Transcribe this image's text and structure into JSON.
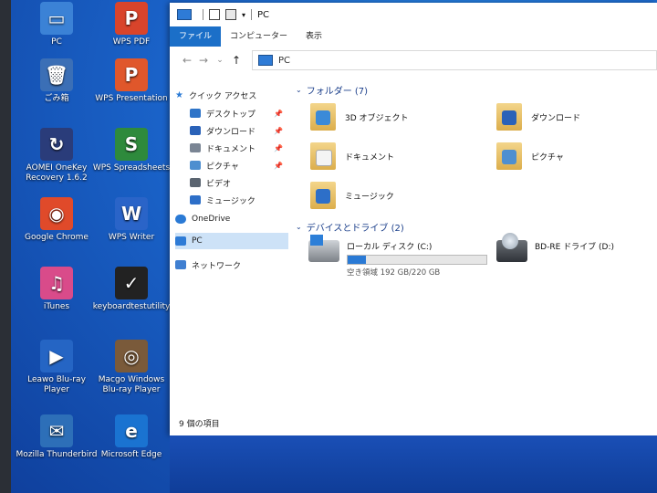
{
  "desktop": {
    "icons": [
      {
        "label": "PC",
        "glyph": "▭",
        "color": "#3b82d6"
      },
      {
        "label": "WPS PDF",
        "glyph": "P",
        "color": "#d9442b"
      },
      {
        "label": "ごみ箱",
        "glyph": "🗑",
        "color": "#3b6fb6"
      },
      {
        "label": "WPS Presentation",
        "glyph": "P",
        "color": "#e0572b"
      },
      {
        "label": "AOMEI OneKey Recovery 1.6.2",
        "glyph": "↻",
        "color": "#2a3c7a"
      },
      {
        "label": "WPS Spreadsheets",
        "glyph": "S",
        "color": "#2e8a3c"
      },
      {
        "label": "Google Chrome",
        "glyph": "◉",
        "color": "#e04a2a"
      },
      {
        "label": "WPS Writer",
        "glyph": "W",
        "color": "#2a64c8"
      },
      {
        "label": "iTunes",
        "glyph": "♫",
        "color": "#d94b8a"
      },
      {
        "label": "keyboardtestutility",
        "glyph": "✓",
        "color": "#222222"
      },
      {
        "label": "Leawo Blu-ray Player",
        "glyph": "▶",
        "color": "#2565c4"
      },
      {
        "label": "Macgo Windows Blu-ray Player",
        "glyph": "◎",
        "color": "#7a5a3a"
      },
      {
        "label": "Mozilla Thunderbird",
        "glyph": "✉",
        "color": "#2d6fb8"
      },
      {
        "label": "Microsoft Edge",
        "glyph": "e",
        "color": "#1a73d1"
      }
    ]
  },
  "window": {
    "title": "PC",
    "ribbon_tabs": [
      "ファイル",
      "コンピューター",
      "表示"
    ],
    "address": "PC",
    "nav_back": "←",
    "nav_forward": "→",
    "nav_recent": "⌄",
    "nav_up": "↑",
    "title_chevron": "▾"
  },
  "navpane": {
    "quick_access": "クイック アクセス",
    "items": [
      {
        "label": "デスクトップ",
        "pinned": true
      },
      {
        "label": "ダウンロード",
        "pinned": true
      },
      {
        "label": "ドキュメント",
        "pinned": true
      },
      {
        "label": "ピクチャ",
        "pinned": true
      },
      {
        "label": "ビデオ",
        "pinned": false
      },
      {
        "label": "ミュージック",
        "pinned": false
      }
    ],
    "onedrive": "OneDrive",
    "pc": "PC",
    "network": "ネットワーク",
    "pin_glyph": "📌"
  },
  "folders_section": {
    "heading": "フォルダー (7)",
    "items": [
      "3D オブジェクト",
      "ダウンロード",
      "ドキュメント",
      "ピクチャ",
      "ミュージック"
    ]
  },
  "drives_section": {
    "heading": "デバイスとドライブ (2)",
    "drives": [
      {
        "name": "ローカル ディスク (C:)",
        "free_text": "空き領域 192 GB/220 GB",
        "used_fraction": 0.13
      },
      {
        "name": "BD-RE ドライブ (D:)"
      }
    ]
  },
  "status": {
    "text": "9 個の項目"
  }
}
